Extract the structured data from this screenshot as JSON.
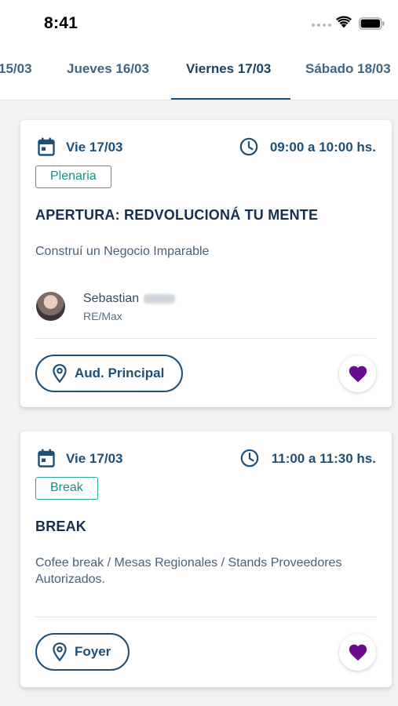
{
  "status_bar": {
    "time": "8:41"
  },
  "tabs": [
    {
      "label": "15/03",
      "active": false
    },
    {
      "label": "Jueves 16/03",
      "active": false
    },
    {
      "label": "Viernes 17/03",
      "active": true
    },
    {
      "label": "Sábado 18/03",
      "active": false
    }
  ],
  "sessions": [
    {
      "date": "Vie 17/03",
      "time": "09:00 a 10:00 hs.",
      "tag": "Plenaria",
      "title": "APERTURA: REDVOLUCIONÁ TU MENTE",
      "description": "Construí un Negocio Imparable",
      "speaker": {
        "name": "Sebastian",
        "org": "RE/Max"
      },
      "location": "Aud. Principal",
      "favorite": true
    },
    {
      "date": "Vie 17/03",
      "time": "11:00 a 11:30 hs.",
      "tag": "Break",
      "title": "BREAK",
      "description": "Cofee break / Mesas Regionales / Stands Proveedores Autorizados.",
      "location": "Foyer",
      "favorite": true
    }
  ],
  "colors": {
    "primary": "#1f4f76",
    "tag": "#2aa79b",
    "favorite": "#6a0c8c"
  }
}
